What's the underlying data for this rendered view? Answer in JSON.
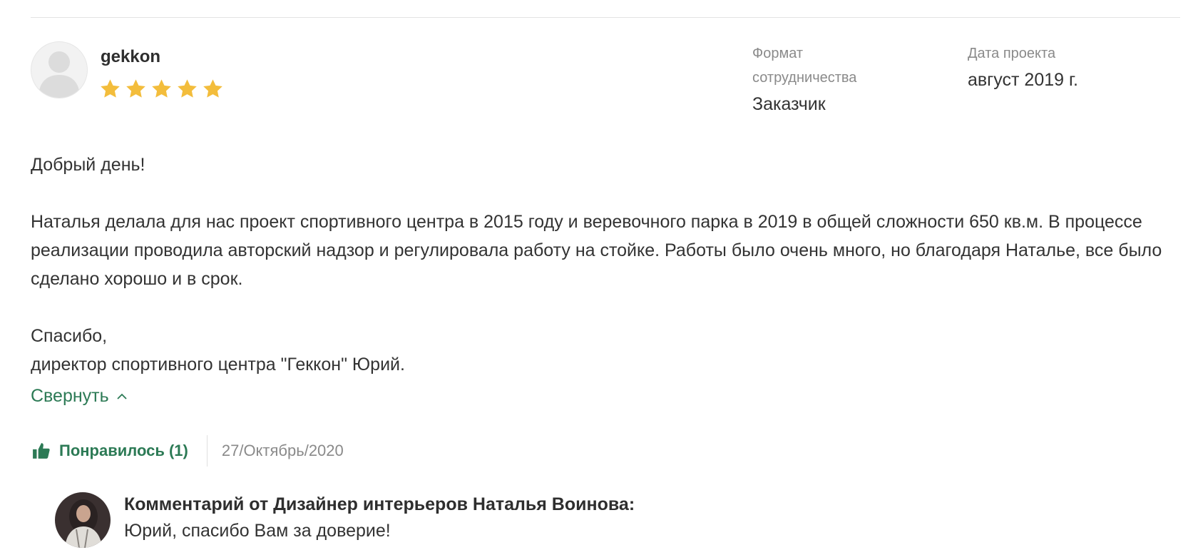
{
  "review": {
    "username": "gekkon",
    "rating": 5,
    "format_label": "Формат сотрудничества",
    "format_value": "Заказчик",
    "date_label": "Дата проекта",
    "date_value": "август 2019 г.",
    "body": {
      "greeting": "Добрый день!",
      "paragraph": "Наталья делала для нас проект спортивного центра в 2015 году и веревочного парка в 2019 в общей сложности 650 кв.м. В процессе реализации проводила авторский надзор и регулировала работу на стойке. Работы было очень много, но благодаря Наталье, все было сделано хорошо и в срок.",
      "thanks": "Спасибо,",
      "signature": "директор спортивного центра \"Геккон\" Юрий."
    },
    "collapse_label": "Свернуть",
    "like_label": "Понравилось (1)",
    "date_posted": "27/Октябрь/2020"
  },
  "comment": {
    "title": "Комментарий от Дизайнер интерьеров Наталья Воинова:",
    "text": "Юрий, спасибо Вам за доверие!"
  },
  "colors": {
    "accent_green": "#2c7a55",
    "star_gold": "#f3bd3c",
    "muted_gray": "#8a8a8a",
    "text": "#333333"
  },
  "icons": [
    "user-placeholder-icon",
    "star-icon",
    "chevron-up-icon",
    "thumbs-up-icon"
  ]
}
